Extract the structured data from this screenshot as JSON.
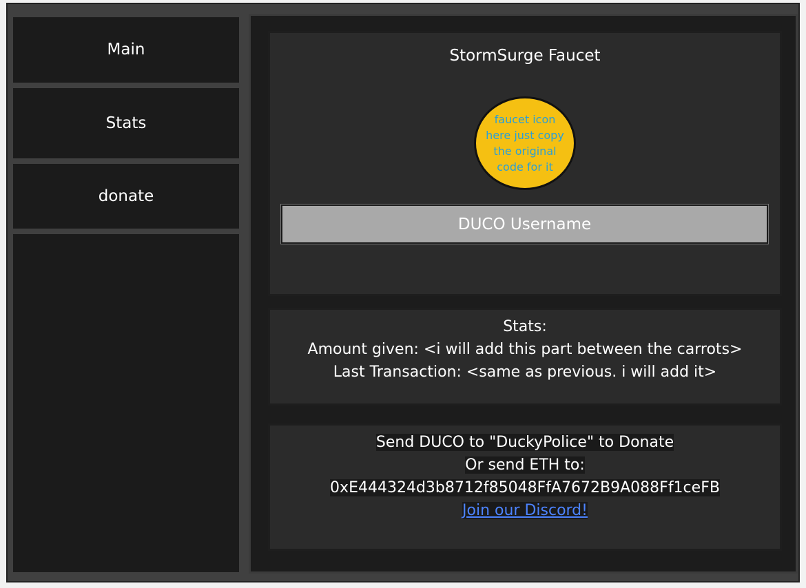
{
  "sidebar": {
    "items": [
      {
        "label": "Main"
      },
      {
        "label": "Stats"
      },
      {
        "label": "donate"
      }
    ]
  },
  "faucet": {
    "title": "StormSurge Faucet",
    "icon_text": "faucet icon here just copy the original code for it",
    "username_placeholder": "DUCO Username"
  },
  "stats": {
    "heading": "Stats:",
    "amount_given": "Amount given: <i will add this part between the carrots>",
    "last_transaction": "Last Transaction: <same as previous. i will add it>"
  },
  "donate": {
    "line1": "Send DUCO to \"DuckyPolice\" to Donate",
    "line2": "Or send ETH to:",
    "eth_address": "0xE444324d3b8712f85048FfA7672B9A088Ff1ceFB",
    "discord_link": "Join our Discord!"
  },
  "colors": {
    "frame": "#404040",
    "panel": "#1c1c1c",
    "card": "#2b2b2b",
    "icon_fill": "#f5c012",
    "icon_text": "#2b9fd6",
    "input_bg": "#a9a9a9",
    "link": "#4c83ff"
  }
}
